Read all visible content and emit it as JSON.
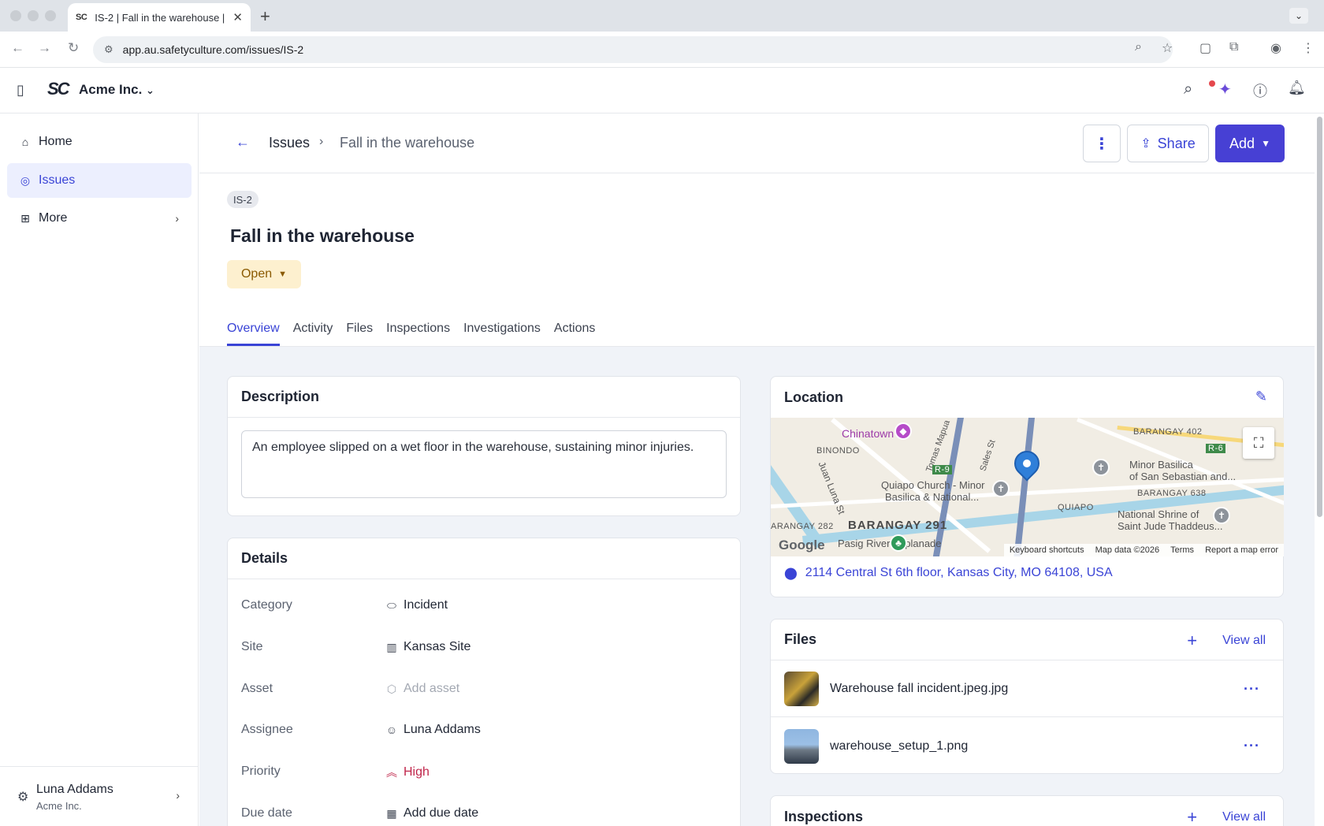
{
  "browser": {
    "tab_title": "IS-2 | Fall in the warehouse |",
    "tab_favicon": "SC",
    "url": "app.au.safetyculture.com/issues/IS-2"
  },
  "header": {
    "org_name": "Acme Inc.",
    "logo_text": "SC"
  },
  "sidebar": {
    "items": [
      {
        "label": "Home",
        "icon": "home-icon"
      },
      {
        "label": "Issues",
        "icon": "issues-icon",
        "active": true
      },
      {
        "label": "More",
        "icon": "grid-icon"
      }
    ],
    "user": {
      "name": "Luna Addams",
      "org": "Acme Inc."
    }
  },
  "breadcrumb": {
    "parent": "Issues",
    "current": "Fall in the warehouse"
  },
  "actions": {
    "share_label": "Share",
    "add_label": "Add"
  },
  "issue": {
    "id": "IS-2",
    "title": "Fall in the warehouse",
    "status": "Open",
    "status_color": "#fdf0cf"
  },
  "tabs": [
    "Overview",
    "Activity",
    "Files",
    "Inspections",
    "Investigations",
    "Actions"
  ],
  "description": {
    "title": "Description",
    "text": "An employee slipped on a wet floor in the warehouse, sustaining minor injuries."
  },
  "details": {
    "title": "Details",
    "rows": [
      {
        "label": "Category",
        "value": "Incident",
        "icon": "tag-icon"
      },
      {
        "label": "Site",
        "value": "Kansas Site",
        "icon": "building-icon"
      },
      {
        "label": "Asset",
        "value": "Add asset",
        "icon": "cube-icon"
      },
      {
        "label": "Assignee",
        "value": "Luna Addams",
        "icon": "user-icon"
      },
      {
        "label": "Priority",
        "value": "High",
        "icon": "priority-high-icon"
      },
      {
        "label": "Due date",
        "value": "Add due date",
        "icon": "calendar-icon"
      }
    ]
  },
  "location": {
    "title": "Location",
    "address": "2114 Central St 6th floor, Kansas City, MO 64108, USA",
    "map": {
      "labels": [
        "Chinatown",
        "BINONDO",
        "Quiapo Church - Minor",
        "Basilica & National...",
        "BARANGAY 291",
        "QUIAPO",
        "BARANGAY 402",
        "Minor Basilica",
        "of San Sebastian and...",
        "BARANGAY 638",
        "National Shrine of",
        "Saint Jude Thaddeus...",
        "ARANGAY 282",
        "Pasig River Esplanade",
        "Juan Luna St",
        "Tomas Mapua",
        "Sales St",
        "R-9",
        "R-6"
      ],
      "attribution": [
        "Keyboard shortcuts",
        "Map data ©2026",
        "Terms",
        "Report a map error"
      ],
      "brand": "Google"
    }
  },
  "files": {
    "title": "Files",
    "view_all": "View all",
    "items": [
      {
        "name": "Warehouse fall incident.jpeg.jpg"
      },
      {
        "name": "warehouse_setup_1.png"
      }
    ]
  },
  "inspections": {
    "title": "Inspections",
    "view_all": "View all"
  }
}
